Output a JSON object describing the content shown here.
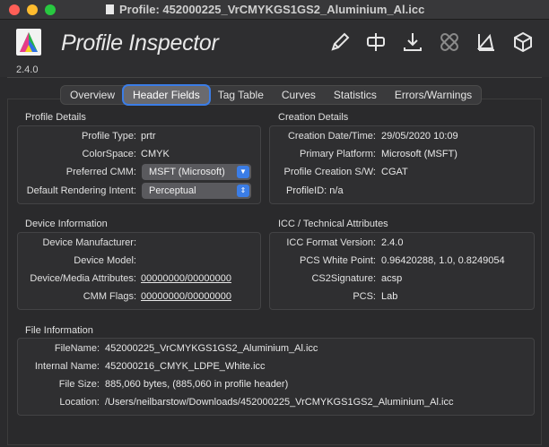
{
  "window": {
    "title": "Profile: 452000225_VrCMYKGS1GS2_Aluminium_Al.icc"
  },
  "app": {
    "name": "Profile Inspector",
    "version": "2.4.0"
  },
  "toolbar": {
    "icons": [
      "pencil-icon",
      "split-icon",
      "download-icon",
      "bandage-icon",
      "gamut-icon",
      "cube-icon"
    ]
  },
  "tabs": [
    "Overview",
    "Header Fields",
    "Tag Table",
    "Curves",
    "Statistics",
    "Errors/Warnings"
  ],
  "active_tab": "Header Fields",
  "profile_details": {
    "title": "Profile Details",
    "profile_type_label": "Profile Type:",
    "profile_type": "prtr",
    "colorspace_label": "ColorSpace:",
    "colorspace": "CMYK",
    "preferred_cmm_label": "Preferred CMM:",
    "preferred_cmm": "MSFT (Microsoft)",
    "rendering_intent_label": "Default Rendering Intent:",
    "rendering_intent": "Perceptual"
  },
  "creation_details": {
    "title": "Creation Details",
    "date_label": "Creation Date/Time:",
    "date": "29/05/2020 10:09",
    "platform_label": "Primary Platform:",
    "platform": "Microsoft (MSFT)",
    "software_label": "Profile Creation S/W:",
    "software": "CGAT",
    "profile_id": "ProfileID: n/a"
  },
  "device_info": {
    "title": "Device Information",
    "manufacturer_label": "Device Manufacturer:",
    "manufacturer": "",
    "model_label": "Device Model:",
    "model": "",
    "attributes_label": "Device/Media Attributes:",
    "attributes": "00000000/00000000",
    "cmm_flags_label": "CMM Flags:",
    "cmm_flags": "00000000/00000000"
  },
  "icc_attributes": {
    "title": "ICC / Technical Attributes",
    "format_label": "ICC Format Version:",
    "format": "2.4.0",
    "white_label": "PCS White Point:",
    "white": "0.96420288, 1.0, 0.8249054",
    "signature_label": "CS2Signature:",
    "signature": "acsp",
    "pcs_label": "PCS:",
    "pcs": "Lab"
  },
  "file_info": {
    "title": "File Information",
    "filename_label": "FileName:",
    "filename": "452000225_VrCMYKGS1GS2_Aluminium_Al.icc",
    "internal_label": "Internal Name:",
    "internal": "452000216_CMYK_LDPE_White.icc",
    "size_label": "File Size:",
    "size": "885,060 bytes, (885,060 in profile header)",
    "location_label": "Location:",
    "location": "/Users/neilbarstow/Downloads/452000225_VrCMYKGS1GS2_Aluminium_Al.icc"
  },
  "colors": {
    "accent": "#3b7de6",
    "background": "#2b2b2d"
  }
}
